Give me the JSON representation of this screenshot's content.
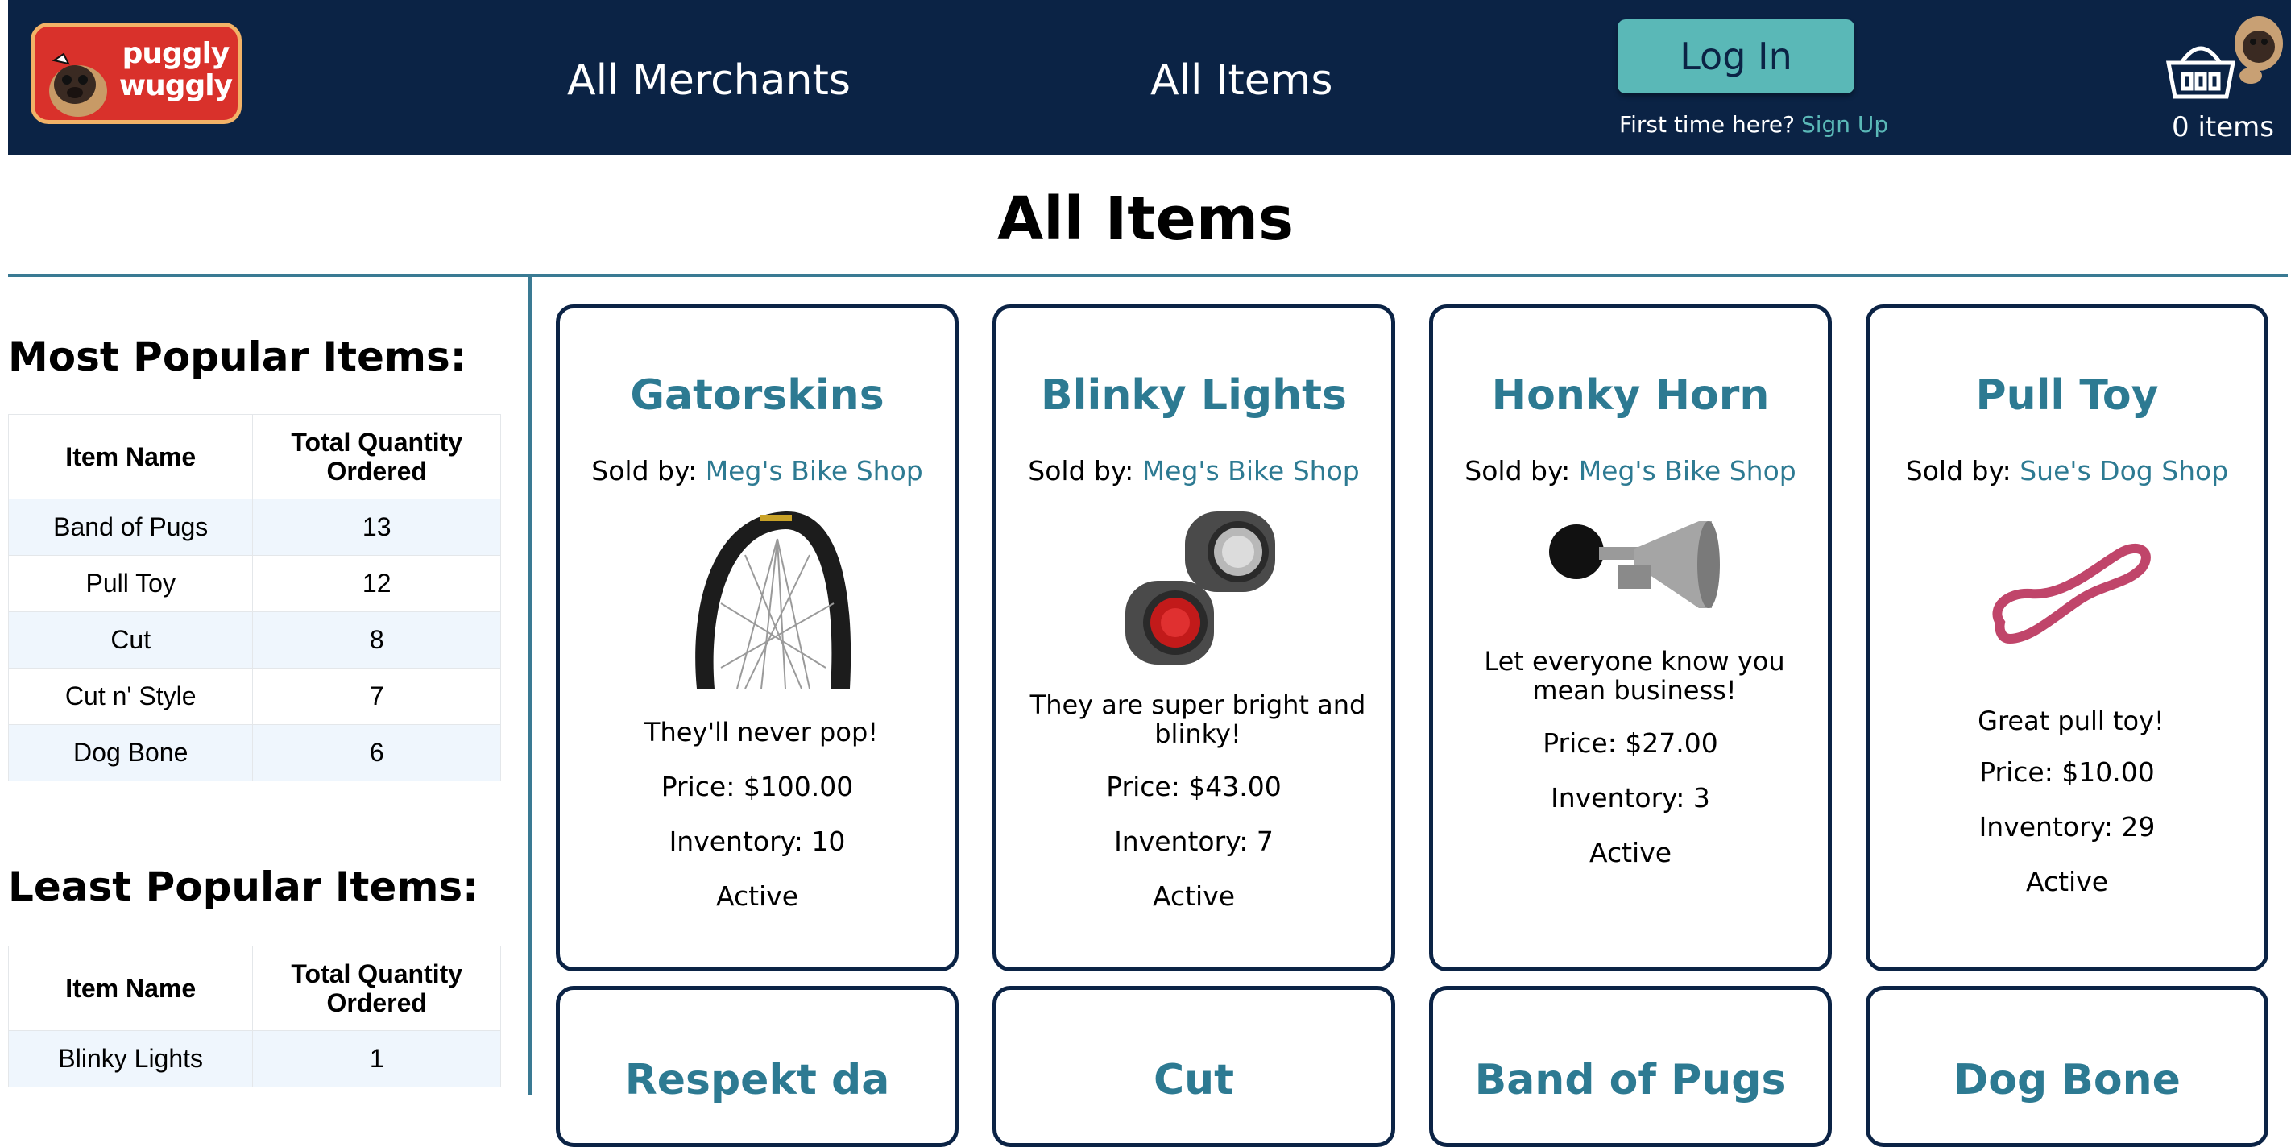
{
  "nav": {
    "logo_line1": "puggly",
    "logo_line2": "wuggly",
    "merchants_label": "All Merchants",
    "items_label": "All Items",
    "login_label": "Log In",
    "first_time_text": "First time here?",
    "signup_label": "Sign Up",
    "cart_count": "0 items"
  },
  "page": {
    "title": "All Items"
  },
  "sidebar": {
    "most_popular": {
      "heading": "Most Popular Items:",
      "col_name": "Item Name",
      "col_qty": "Total Quantity Ordered",
      "rows": [
        {
          "name": "Band of Pugs",
          "qty": "13"
        },
        {
          "name": "Pull Toy",
          "qty": "12"
        },
        {
          "name": "Cut",
          "qty": "8"
        },
        {
          "name": "Cut n' Style",
          "qty": "7"
        },
        {
          "name": "Dog Bone",
          "qty": "6"
        }
      ]
    },
    "least_popular": {
      "heading": "Least Popular Items:",
      "col_name": "Item Name",
      "col_qty": "Total Quantity Ordered",
      "rows": [
        {
          "name": "Blinky Lights",
          "qty": "1"
        }
      ]
    }
  },
  "items": [
    {
      "name": "Gatorskins",
      "sold_by_label": "Sold by:",
      "merchant": "Meg's Bike Shop",
      "description": "They'll never pop!",
      "price": "Price: $100.00",
      "inventory": "Inventory: 10",
      "status": "Active",
      "image": "bike-tire"
    },
    {
      "name": "Blinky Lights",
      "sold_by_label": "Sold by:",
      "merchant": "Meg's Bike Shop",
      "description": "They are super bright and blinky!",
      "price": "Price: $43.00",
      "inventory": "Inventory: 7",
      "status": "Active",
      "image": "bike-lights"
    },
    {
      "name": "Honky Horn",
      "sold_by_label": "Sold by:",
      "merchant": "Meg's Bike Shop",
      "description": "Let everyone know you mean business!",
      "price": "Price: $27.00",
      "inventory": "Inventory: 3",
      "status": "Active",
      "image": "bike-horn"
    },
    {
      "name": "Pull Toy",
      "sold_by_label": "Sold by:",
      "merchant": "Sue's Dog Shop",
      "description": "Great pull toy!",
      "price": "Price: $10.00",
      "inventory": "Inventory: 29",
      "status": "Active",
      "image": "pull-toy"
    },
    {
      "name": "Respekt da"
    },
    {
      "name": "Cut"
    },
    {
      "name": "Band of Pugs"
    },
    {
      "name": "Dog Bone"
    }
  ],
  "colors": {
    "nav_bg": "#0b2345",
    "accent": "#5ab8b7",
    "link": "#2d7a92",
    "logo_red": "#d9312b"
  }
}
